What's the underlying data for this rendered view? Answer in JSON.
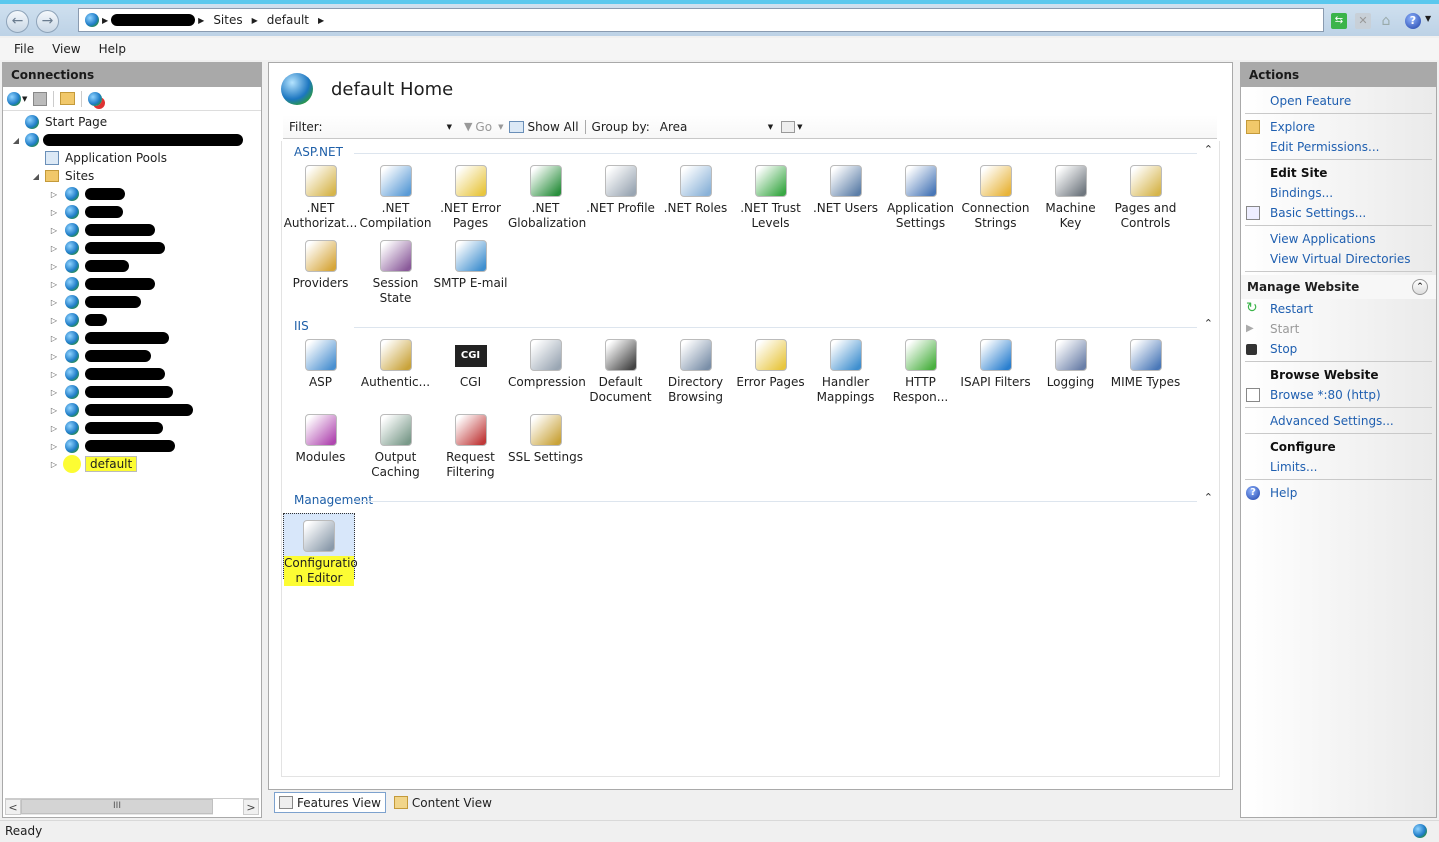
{
  "window": {
    "address_crumbs": [
      "[redacted server]",
      "Sites",
      "default"
    ],
    "toolbar_icons": [
      "refresh-icon",
      "stop-icon",
      "home-icon",
      "help-icon"
    ]
  },
  "menu": [
    "File",
    "View",
    "Help"
  ],
  "connections": {
    "title": "Connections",
    "toolbar_icons": [
      "connect-icon",
      "save-icon",
      "folder-up-icon",
      "disconnect-icon"
    ],
    "tree": {
      "start_page": "Start Page",
      "server": "[redacted]",
      "app_pools": "Application Pools",
      "sites": "Sites",
      "site_items": [
        "[redacted]",
        "[redacted]",
        "[redacted]",
        "[redacted]",
        "[redacted]",
        "[redacted]",
        "[redacted]",
        "[redacted]",
        "[redacted]",
        "[redacted]",
        "[redacted]",
        "[redacted]",
        "[redacted]",
        "[redacted]",
        "[redacted]"
      ],
      "selected_site": "default"
    }
  },
  "main": {
    "title": "default Home",
    "filter": {
      "label": "Filter:",
      "value": "",
      "go": "Go",
      "show_all": "Show All",
      "group_by_label": "Group by:",
      "group_by_value": "Area"
    },
    "groups": [
      {
        "name": "ASP.NET",
        "features": [
          [
            ".NET",
            "Authorizat..."
          ],
          [
            ".NET",
            "Compilation"
          ],
          [
            ".NET Error",
            "Pages"
          ],
          [
            ".NET",
            "Globalization"
          ],
          [
            ".NET Profile",
            ""
          ],
          [
            ".NET Roles",
            ""
          ],
          [
            ".NET Trust",
            "Levels"
          ],
          [
            ".NET Users",
            ""
          ],
          [
            "Application",
            "Settings"
          ],
          [
            "Connection",
            "Strings"
          ],
          [
            "Machine Key",
            ""
          ],
          [
            "Pages and",
            "Controls"
          ],
          [
            "Providers",
            ""
          ],
          [
            "Session State",
            ""
          ],
          [
            "SMTP E-mail",
            ""
          ]
        ]
      },
      {
        "name": "IIS",
        "features": [
          [
            "ASP",
            ""
          ],
          [
            "Authentic...",
            ""
          ],
          [
            "CGI",
            ""
          ],
          [
            "Compression",
            ""
          ],
          [
            "Default",
            "Document"
          ],
          [
            "Directory",
            "Browsing"
          ],
          [
            "Error Pages",
            ""
          ],
          [
            "Handler",
            "Mappings"
          ],
          [
            "HTTP",
            "Respon..."
          ],
          [
            "ISAPI Filters",
            ""
          ],
          [
            "Logging",
            ""
          ],
          [
            "MIME Types",
            ""
          ],
          [
            "Modules",
            ""
          ],
          [
            "Output",
            "Caching"
          ],
          [
            "Request",
            "Filtering"
          ],
          [
            "SSL Settings",
            ""
          ]
        ]
      },
      {
        "name": "Management",
        "features": [
          [
            "Configuratio",
            "n Editor"
          ]
        ]
      }
    ],
    "view_tabs": [
      "Features View",
      "Content View"
    ],
    "active_view": "Features View"
  },
  "actions": {
    "title": "Actions",
    "open_feature": "Open Feature",
    "explore": "Explore",
    "edit_permissions": "Edit Permissions...",
    "edit_site": "Edit Site",
    "bindings": "Bindings...",
    "basic_settings": "Basic Settings...",
    "view_applications": "View Applications",
    "view_virtual_dirs": "View Virtual Directories",
    "manage_website": "Manage Website",
    "restart": "Restart",
    "start": "Start",
    "stop": "Stop",
    "browse_website": "Browse Website",
    "browse_80": "Browse *:80 (http)",
    "advanced_settings": "Advanced Settings...",
    "configure": "Configure",
    "limits": "Limits...",
    "help": "Help"
  },
  "status": {
    "text": "Ready"
  }
}
